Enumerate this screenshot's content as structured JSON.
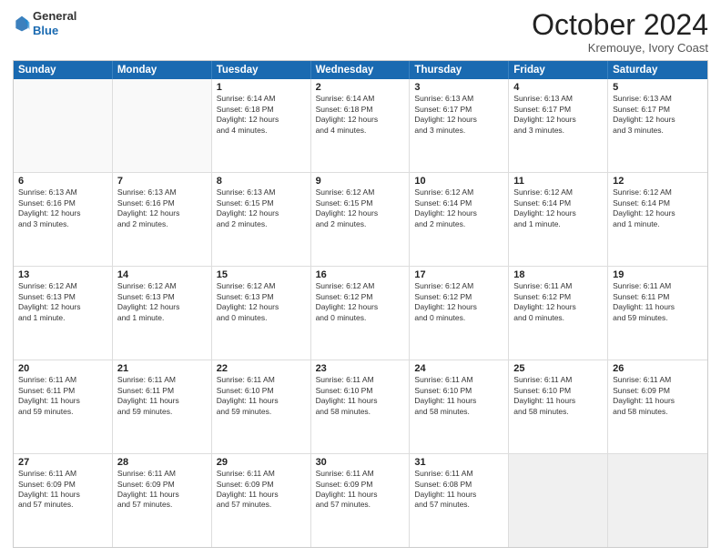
{
  "header": {
    "logo_general": "General",
    "logo_blue": "Blue",
    "month_title": "October 2024",
    "location": "Kremouye, Ivory Coast"
  },
  "weekdays": [
    "Sunday",
    "Monday",
    "Tuesday",
    "Wednesday",
    "Thursday",
    "Friday",
    "Saturday"
  ],
  "rows": [
    [
      {
        "day": "",
        "lines": [],
        "empty": true
      },
      {
        "day": "",
        "lines": [],
        "empty": true
      },
      {
        "day": "1",
        "lines": [
          "Sunrise: 6:14 AM",
          "Sunset: 6:18 PM",
          "Daylight: 12 hours",
          "and 4 minutes."
        ]
      },
      {
        "day": "2",
        "lines": [
          "Sunrise: 6:14 AM",
          "Sunset: 6:18 PM",
          "Daylight: 12 hours",
          "and 4 minutes."
        ]
      },
      {
        "day": "3",
        "lines": [
          "Sunrise: 6:13 AM",
          "Sunset: 6:17 PM",
          "Daylight: 12 hours",
          "and 3 minutes."
        ]
      },
      {
        "day": "4",
        "lines": [
          "Sunrise: 6:13 AM",
          "Sunset: 6:17 PM",
          "Daylight: 12 hours",
          "and 3 minutes."
        ]
      },
      {
        "day": "5",
        "lines": [
          "Sunrise: 6:13 AM",
          "Sunset: 6:17 PM",
          "Daylight: 12 hours",
          "and 3 minutes."
        ]
      }
    ],
    [
      {
        "day": "6",
        "lines": [
          "Sunrise: 6:13 AM",
          "Sunset: 6:16 PM",
          "Daylight: 12 hours",
          "and 3 minutes."
        ]
      },
      {
        "day": "7",
        "lines": [
          "Sunrise: 6:13 AM",
          "Sunset: 6:16 PM",
          "Daylight: 12 hours",
          "and 2 minutes."
        ]
      },
      {
        "day": "8",
        "lines": [
          "Sunrise: 6:13 AM",
          "Sunset: 6:15 PM",
          "Daylight: 12 hours",
          "and 2 minutes."
        ]
      },
      {
        "day": "9",
        "lines": [
          "Sunrise: 6:12 AM",
          "Sunset: 6:15 PM",
          "Daylight: 12 hours",
          "and 2 minutes."
        ]
      },
      {
        "day": "10",
        "lines": [
          "Sunrise: 6:12 AM",
          "Sunset: 6:14 PM",
          "Daylight: 12 hours",
          "and 2 minutes."
        ]
      },
      {
        "day": "11",
        "lines": [
          "Sunrise: 6:12 AM",
          "Sunset: 6:14 PM",
          "Daylight: 12 hours",
          "and 1 minute."
        ]
      },
      {
        "day": "12",
        "lines": [
          "Sunrise: 6:12 AM",
          "Sunset: 6:14 PM",
          "Daylight: 12 hours",
          "and 1 minute."
        ]
      }
    ],
    [
      {
        "day": "13",
        "lines": [
          "Sunrise: 6:12 AM",
          "Sunset: 6:13 PM",
          "Daylight: 12 hours",
          "and 1 minute."
        ]
      },
      {
        "day": "14",
        "lines": [
          "Sunrise: 6:12 AM",
          "Sunset: 6:13 PM",
          "Daylight: 12 hours",
          "and 1 minute."
        ]
      },
      {
        "day": "15",
        "lines": [
          "Sunrise: 6:12 AM",
          "Sunset: 6:13 PM",
          "Daylight: 12 hours",
          "and 0 minutes."
        ]
      },
      {
        "day": "16",
        "lines": [
          "Sunrise: 6:12 AM",
          "Sunset: 6:12 PM",
          "Daylight: 12 hours",
          "and 0 minutes."
        ]
      },
      {
        "day": "17",
        "lines": [
          "Sunrise: 6:12 AM",
          "Sunset: 6:12 PM",
          "Daylight: 12 hours",
          "and 0 minutes."
        ]
      },
      {
        "day": "18",
        "lines": [
          "Sunrise: 6:11 AM",
          "Sunset: 6:12 PM",
          "Daylight: 12 hours",
          "and 0 minutes."
        ]
      },
      {
        "day": "19",
        "lines": [
          "Sunrise: 6:11 AM",
          "Sunset: 6:11 PM",
          "Daylight: 11 hours",
          "and 59 minutes."
        ]
      }
    ],
    [
      {
        "day": "20",
        "lines": [
          "Sunrise: 6:11 AM",
          "Sunset: 6:11 PM",
          "Daylight: 11 hours",
          "and 59 minutes."
        ]
      },
      {
        "day": "21",
        "lines": [
          "Sunrise: 6:11 AM",
          "Sunset: 6:11 PM",
          "Daylight: 11 hours",
          "and 59 minutes."
        ]
      },
      {
        "day": "22",
        "lines": [
          "Sunrise: 6:11 AM",
          "Sunset: 6:10 PM",
          "Daylight: 11 hours",
          "and 59 minutes."
        ]
      },
      {
        "day": "23",
        "lines": [
          "Sunrise: 6:11 AM",
          "Sunset: 6:10 PM",
          "Daylight: 11 hours",
          "and 58 minutes."
        ]
      },
      {
        "day": "24",
        "lines": [
          "Sunrise: 6:11 AM",
          "Sunset: 6:10 PM",
          "Daylight: 11 hours",
          "and 58 minutes."
        ]
      },
      {
        "day": "25",
        "lines": [
          "Sunrise: 6:11 AM",
          "Sunset: 6:10 PM",
          "Daylight: 11 hours",
          "and 58 minutes."
        ]
      },
      {
        "day": "26",
        "lines": [
          "Sunrise: 6:11 AM",
          "Sunset: 6:09 PM",
          "Daylight: 11 hours",
          "and 58 minutes."
        ]
      }
    ],
    [
      {
        "day": "27",
        "lines": [
          "Sunrise: 6:11 AM",
          "Sunset: 6:09 PM",
          "Daylight: 11 hours",
          "and 57 minutes."
        ]
      },
      {
        "day": "28",
        "lines": [
          "Sunrise: 6:11 AM",
          "Sunset: 6:09 PM",
          "Daylight: 11 hours",
          "and 57 minutes."
        ]
      },
      {
        "day": "29",
        "lines": [
          "Sunrise: 6:11 AM",
          "Sunset: 6:09 PM",
          "Daylight: 11 hours",
          "and 57 minutes."
        ]
      },
      {
        "day": "30",
        "lines": [
          "Sunrise: 6:11 AM",
          "Sunset: 6:09 PM",
          "Daylight: 11 hours",
          "and 57 minutes."
        ]
      },
      {
        "day": "31",
        "lines": [
          "Sunrise: 6:11 AM",
          "Sunset: 6:08 PM",
          "Daylight: 11 hours",
          "and 57 minutes."
        ]
      },
      {
        "day": "",
        "lines": [],
        "empty": true,
        "shaded": true
      },
      {
        "day": "",
        "lines": [],
        "empty": true,
        "shaded": true
      }
    ]
  ]
}
